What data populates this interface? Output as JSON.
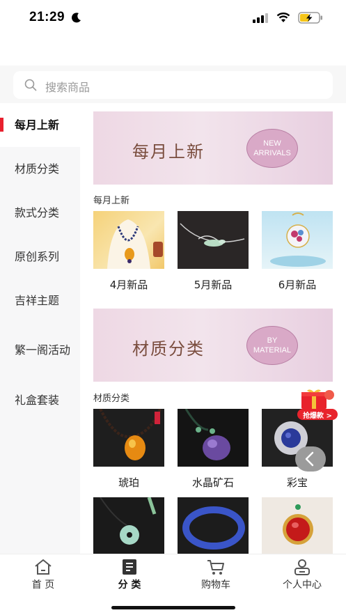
{
  "status_bar": {
    "time": "21:29"
  },
  "search": {
    "placeholder": "搜索商品"
  },
  "sidebar": {
    "items": [
      {
        "label": "每月上新",
        "active": true
      },
      {
        "label": "材质分类"
      },
      {
        "label": "款式分类"
      },
      {
        "label": "原创系列"
      },
      {
        "label": "吉祥主题"
      },
      {
        "label": "繁一阁活动"
      },
      {
        "label": "礼盒套装"
      }
    ]
  },
  "sections": [
    {
      "banner_title": "每月上新",
      "banner_badge": [
        "NEW",
        "ARRIVALS"
      ],
      "title": "每月上新",
      "products": [
        {
          "name": "4月新品"
        },
        {
          "name": "5月新品"
        },
        {
          "name": "6月新品"
        }
      ]
    },
    {
      "banner_title": "材质分类",
      "banner_badge": [
        "BY",
        "MATERIAL"
      ],
      "title": "材质分类",
      "products": [
        {
          "name": "琥珀"
        },
        {
          "name": "水晶矿石"
        },
        {
          "name": "彩宝"
        }
      ]
    }
  ],
  "promo": {
    "label": "抢爆款 >"
  },
  "tab_bar": {
    "items": [
      {
        "label": "首 页",
        "icon": "home-icon"
      },
      {
        "label": "分 类",
        "icon": "category-icon",
        "active": true
      },
      {
        "label": "购物车",
        "icon": "cart-icon"
      },
      {
        "label": "个人中心",
        "icon": "profile-icon"
      }
    ]
  },
  "colors": {
    "accent": "#e8202e",
    "banner_pink": "#eed8e4",
    "badge": "#d9a9c7"
  }
}
